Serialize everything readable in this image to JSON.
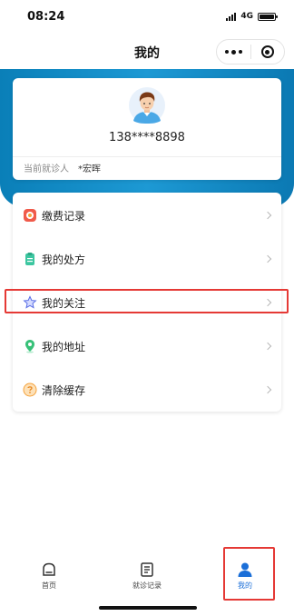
{
  "status_bar": {
    "time": "08:24",
    "network": "4G"
  },
  "nav": {
    "title": "我的"
  },
  "profile": {
    "phone": "138****8898",
    "patient_label": "当前就诊人",
    "patient_name": "*宏晖"
  },
  "menu": {
    "items": [
      {
        "label": "缴费记录",
        "icon": "payment-record-icon"
      },
      {
        "label": "我的处方",
        "icon": "prescription-icon"
      },
      {
        "label": "我的关注",
        "icon": "star-icon"
      },
      {
        "label": "我的地址",
        "icon": "location-pin-icon"
      },
      {
        "label": "清除缓存",
        "icon": "clear-cache-icon"
      }
    ]
  },
  "tabs": [
    {
      "label": "首页",
      "icon": "home-icon",
      "active": false
    },
    {
      "label": "就诊记录",
      "icon": "records-icon",
      "active": false
    },
    {
      "label": "我的",
      "icon": "user-icon",
      "active": true
    }
  ],
  "colors": {
    "accent": "#1b6fd8",
    "banner": "#1d99d4",
    "highlight": "#e53935"
  }
}
